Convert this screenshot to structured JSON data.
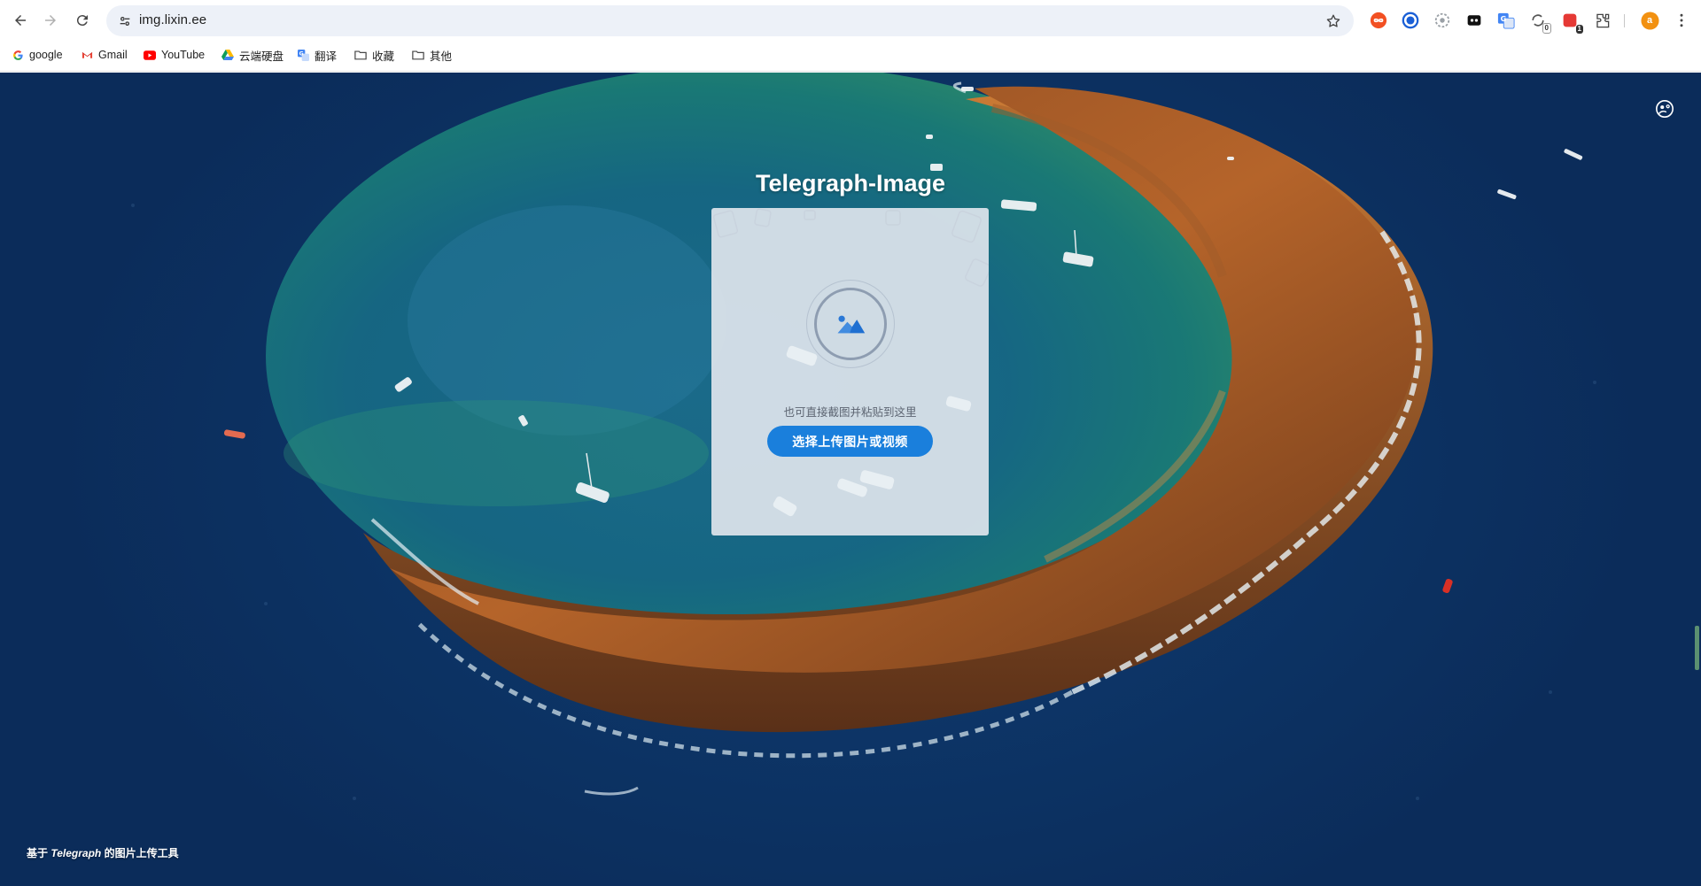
{
  "browser": {
    "url": "img.lixin.ee",
    "bookmarks": [
      {
        "label": "google",
        "icon": "google-icon"
      },
      {
        "label": "Gmail",
        "icon": "gmail-icon"
      },
      {
        "label": "YouTube",
        "icon": "youtube-icon"
      },
      {
        "label": "云端硬盘",
        "icon": "drive-icon"
      },
      {
        "label": "翻译",
        "icon": "translate-icon"
      },
      {
        "label": "收藏",
        "icon": "folder-icon"
      },
      {
        "label": "其他",
        "icon": "folder-icon"
      }
    ],
    "extensions": [
      {
        "icon": "infinity-extension-icon",
        "color": "#f25022"
      },
      {
        "icon": "circle-extension-icon",
        "color": "#1a5fd6"
      },
      {
        "icon": "gear-extension-icon",
        "color": "#9aa0a6"
      },
      {
        "icon": "bot-extension-icon",
        "color": "#111111"
      },
      {
        "icon": "translate-extension-icon",
        "color": "#4285f4"
      },
      {
        "icon": "sync-extension-icon",
        "color": "#555555",
        "badge": "0"
      },
      {
        "icon": "red-extension-icon",
        "color": "#e53935",
        "badge": "1"
      }
    ],
    "profile_initial": "a",
    "profile_color": "#f29111"
  },
  "page": {
    "title": "Telegraph-Image",
    "upload": {
      "hint": "也可直接截图并粘贴到这里",
      "button_label": "选择上传图片或视频"
    },
    "footer_prefix": "基于 ",
    "footer_brand": "Telegraph",
    "footer_suffix": " 的图片上传工具"
  }
}
